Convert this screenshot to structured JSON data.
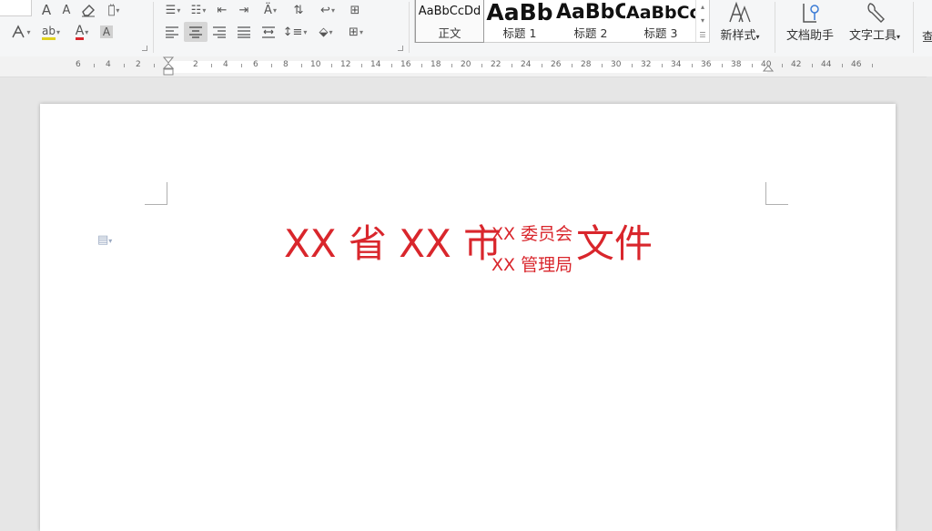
{
  "ribbon": {
    "font_color": "#d9262c",
    "styles": [
      {
        "preview": "AaBbCcDd",
        "label": "正文"
      },
      {
        "preview": "AaBb",
        "label": "标题 1"
      },
      {
        "preview": "AaBbC",
        "label": "标题 2"
      },
      {
        "preview": "AaBbCc",
        "label": "标题 3"
      }
    ],
    "new_style_label": "新样式",
    "doc_helper_label": "文档助手",
    "text_tools_label": "文字工具",
    "overflow_label": "查"
  },
  "ruler": {
    "left_marks": [
      "6",
      "4",
      "2"
    ],
    "marks": [
      "2",
      "4",
      "6",
      "8",
      "10",
      "12",
      "14",
      "16",
      "18",
      "20",
      "22",
      "24",
      "26",
      "28",
      "30",
      "32",
      "34",
      "36",
      "38",
      "40"
    ],
    "right_marks": [
      "42",
      "44",
      "46"
    ]
  },
  "document": {
    "title_prefix": "XX 省 XX 市",
    "title_org_1": "XX 委员会",
    "title_org_2": "XX 管理局",
    "title_suffix": "文件",
    "title_color": "#d9262c"
  }
}
